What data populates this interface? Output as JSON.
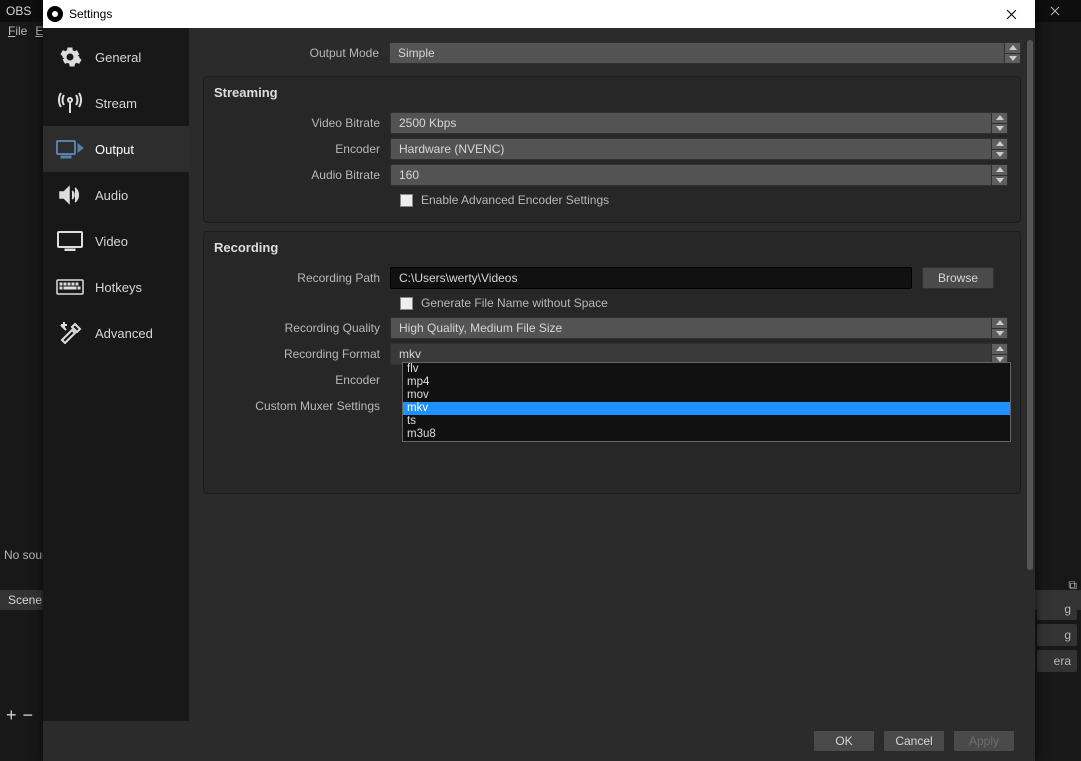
{
  "back": {
    "title_prefix": "OBS",
    "menu_file": "File",
    "menu_edit": "E",
    "no_sources": "No sourc",
    "scene_label": "Scene",
    "rbtn1": "g",
    "rbtn2": "g",
    "rbtn3": "era",
    "plus": "+",
    "minus": "−"
  },
  "dialog": {
    "title": "Settings",
    "close": "✕"
  },
  "sidebar": {
    "items": [
      {
        "label": "General"
      },
      {
        "label": "Stream"
      },
      {
        "label": "Output"
      },
      {
        "label": "Audio"
      },
      {
        "label": "Video"
      },
      {
        "label": "Hotkeys"
      },
      {
        "label": "Advanced"
      }
    ]
  },
  "top": {
    "output_mode_label": "Output Mode",
    "output_mode_value": "Simple"
  },
  "streaming": {
    "heading": "Streaming",
    "video_bitrate_label": "Video Bitrate",
    "video_bitrate_value": "2500 Kbps",
    "encoder_label": "Encoder",
    "encoder_value": "Hardware (NVENC)",
    "audio_bitrate_label": "Audio Bitrate",
    "audio_bitrate_value": "160",
    "adv_check": "Enable Advanced Encoder Settings"
  },
  "recording": {
    "heading": "Recording",
    "path_label": "Recording Path",
    "path_value": "C:\\Users\\werty\\Videos",
    "browse": "Browse",
    "gen_check": "Generate File Name without Space",
    "quality_label": "Recording Quality",
    "quality_value": "High Quality, Medium File Size",
    "format_label": "Recording Format",
    "format_value": "mkv",
    "encoder_label": "Encoder",
    "muxer_label": "Custom Muxer Settings",
    "format_options": [
      "flv",
      "mp4",
      "mov",
      "mkv",
      "ts",
      "m3u8"
    ]
  },
  "footer": {
    "ok": "OK",
    "cancel": "Cancel",
    "apply": "Apply"
  }
}
